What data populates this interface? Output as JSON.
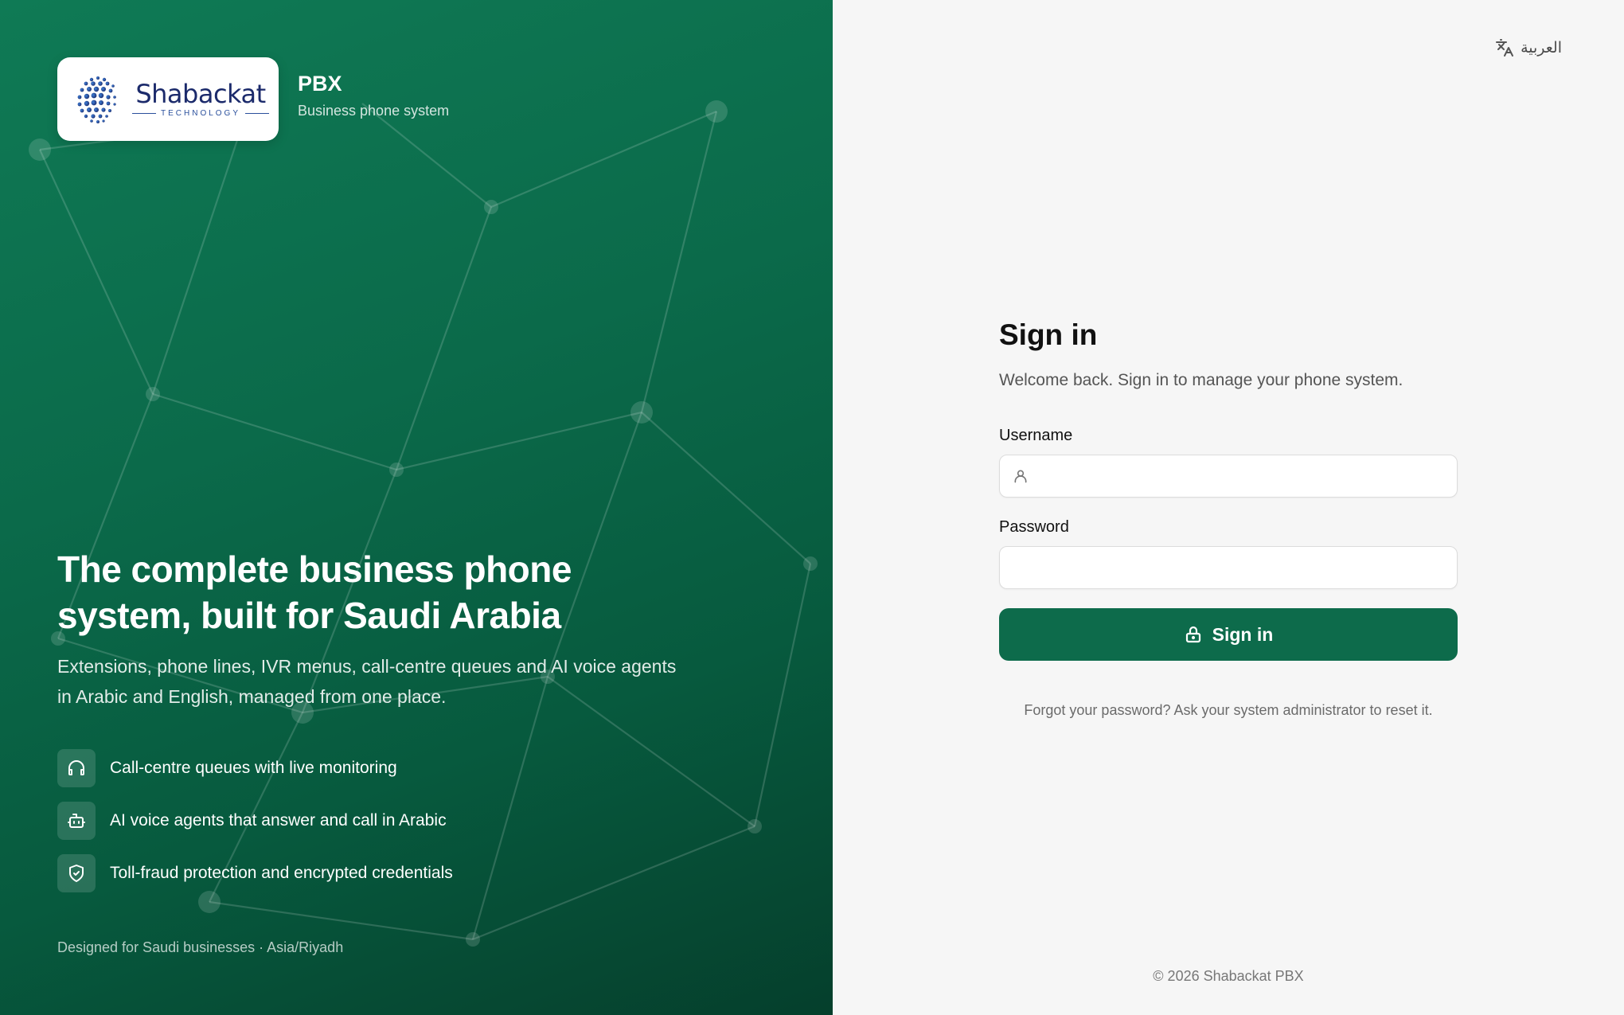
{
  "brand": {
    "logo_name": "Shabackat",
    "logo_sub": "TECHNOLOGY",
    "title": "PBX",
    "tagline": "Business phone system"
  },
  "hero": {
    "headline": "The complete business phone system, built for Saudi Arabia",
    "subhead": "Extensions, phone lines, IVR menus, call-centre queues and AI voice agents in Arabic and English, managed from one place.",
    "features": [
      {
        "icon": "headphones-icon",
        "label": "Call-centre queues with live monitoring"
      },
      {
        "icon": "bot-icon",
        "label": "AI voice agents that answer and call in Arabic"
      },
      {
        "icon": "shield-check-icon",
        "label": "Toll-fraud protection and encrypted credentials"
      }
    ],
    "footer": "Designed for Saudi businesses · Asia/Riyadh"
  },
  "language": {
    "label": "العربية",
    "icon": "translate-icon"
  },
  "form": {
    "title": "Sign in",
    "subtitle": "Welcome back. Sign in to manage your phone system.",
    "username_label": "Username",
    "username_value": "",
    "password_label": "Password",
    "password_value": "",
    "submit_label": "Sign in",
    "forgot_text": "Forgot your password? Ask your system administrator to reset it."
  },
  "footer": {
    "copyright": "© 2026 Shabackat PBX"
  },
  "colors": {
    "hero_green": "#0b6a4a",
    "button_green": "#0d6b4b",
    "background": "#f6f6f6"
  }
}
